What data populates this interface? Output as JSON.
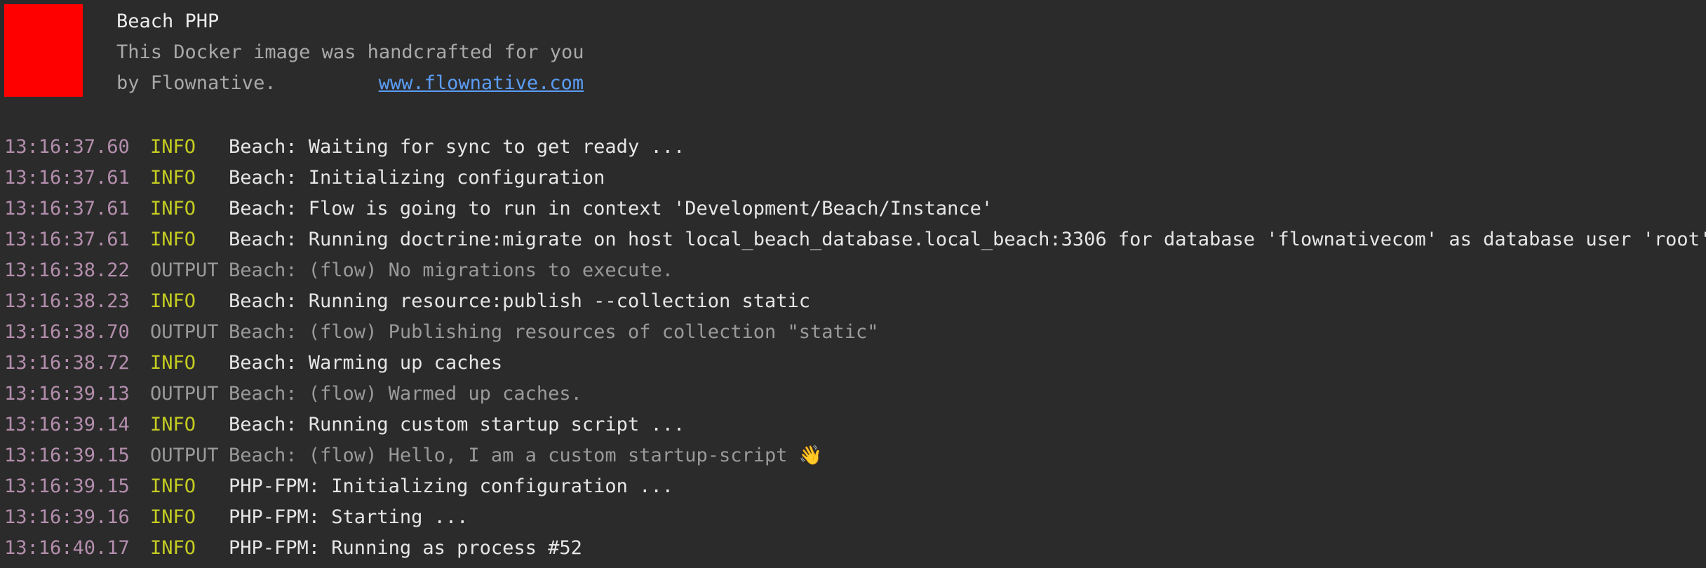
{
  "header": {
    "title": "Beach PHP",
    "description_line1": "This Docker image was handcrafted for you",
    "description_line2": "by Flownative.",
    "link": "www.flownative.com",
    "logo_color": "#ff0000"
  },
  "colors": {
    "background": "#2b2b2b",
    "timestamp": "#b48ead",
    "info": "#c4cc22",
    "output": "#9a9a9a",
    "link": "#5b9cf5"
  },
  "log": [
    {
      "time": "13:16:37.60",
      "level": "INFO",
      "message": "Beach: Waiting for sync to get ready ..."
    },
    {
      "time": "13:16:37.61",
      "level": "INFO",
      "message": "Beach: Initializing configuration"
    },
    {
      "time": "13:16:37.61",
      "level": "INFO",
      "message": "Beach: Flow is going to run in context 'Development/Beach/Instance'"
    },
    {
      "time": "13:16:37.61",
      "level": "INFO",
      "message": "Beach: Running doctrine:migrate on host local_beach_database.local_beach:3306 for database 'flownativecom' as database user 'root'"
    },
    {
      "time": "13:16:38.22",
      "level": "OUTPUT",
      "message": "Beach: (flow) No migrations to execute."
    },
    {
      "time": "13:16:38.23",
      "level": "INFO",
      "message": "Beach: Running resource:publish --collection static"
    },
    {
      "time": "13:16:38.70",
      "level": "OUTPUT",
      "message": "Beach: (flow) Publishing resources of collection \"static\""
    },
    {
      "time": "13:16:38.72",
      "level": "INFO",
      "message": "Beach: Warming up caches"
    },
    {
      "time": "13:16:39.13",
      "level": "OUTPUT",
      "message": "Beach: (flow) Warmed up caches."
    },
    {
      "time": "13:16:39.14",
      "level": "INFO",
      "message": "Beach: Running custom startup script ..."
    },
    {
      "time": "13:16:39.15",
      "level": "OUTPUT",
      "message": "Beach: (flow) Hello, I am a custom startup-script 👋"
    },
    {
      "time": "13:16:39.15",
      "level": "INFO",
      "message": "PHP-FPM: Initializing configuration ..."
    },
    {
      "time": "13:16:39.16",
      "level": "INFO",
      "message": "PHP-FPM: Starting ..."
    },
    {
      "time": "13:16:40.17",
      "level": "INFO",
      "message": "PHP-FPM: Running as process #52"
    }
  ]
}
